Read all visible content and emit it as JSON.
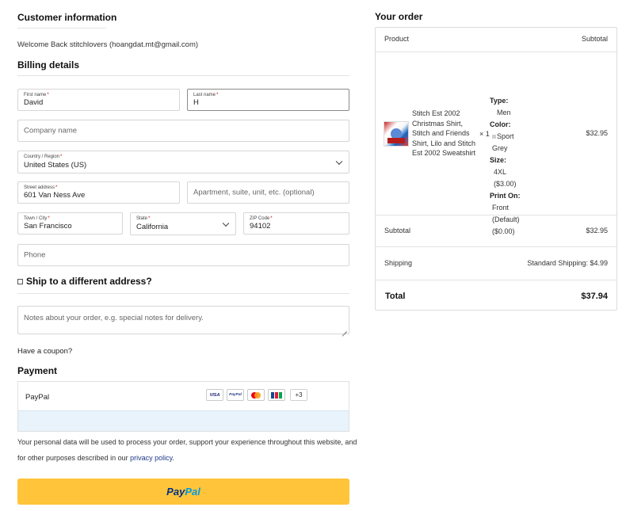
{
  "customer": {
    "title": "Customer information",
    "welcome": "Welcome Back stitchlovers (hoangdat.mt@gmail.com)"
  },
  "billing": {
    "title": "Billing details",
    "first_name": {
      "label": "First name",
      "req": "*",
      "value": "David"
    },
    "last_name": {
      "label": "Last name",
      "req": "*",
      "value": "H"
    },
    "company": {
      "placeholder": "Company name"
    },
    "country": {
      "label": "Country / Region",
      "req": "*",
      "value": "United States (US)"
    },
    "street": {
      "label": "Street address",
      "req": "*",
      "value": "601 Van Ness Ave"
    },
    "apartment": {
      "placeholder": "Apartment, suite, unit, etc. (optional)"
    },
    "city": {
      "label": "Town / City",
      "req": "*",
      "value": "San Francisco"
    },
    "state": {
      "label": "State",
      "req": "*",
      "value": "California"
    },
    "zip": {
      "label": "ZIP Code",
      "req": "*",
      "value": "94102"
    },
    "phone": {
      "placeholder": "Phone"
    }
  },
  "shipping": {
    "label": "Ship to a different address?",
    "checked": false
  },
  "notes": {
    "placeholder": "Notes about your order, e.g. special notes for delivery."
  },
  "coupon": {
    "label": "Have a coupon?"
  },
  "payment": {
    "title": "Payment",
    "method": "PayPal",
    "cards": [
      "visa-card-icon",
      "paypal-card-icon",
      "mastercard-icon",
      "jcb-card-icon"
    ],
    "card_labels": {
      "visa": "VISA",
      "paypal": "PayPal"
    },
    "more": "+3",
    "privacy_text": "Your personal data will be used to process your order, support your experience throughout this website, and for other purposes described in our",
    "privacy_link": "privacy policy",
    "privacy_end": ".",
    "button": {
      "part1": "Pay",
      "part2": "Pal"
    }
  },
  "order": {
    "title": "Your order",
    "header": {
      "product": "Product",
      "subtotal": "Subtotal"
    },
    "item": {
      "name": "Stitch Est 2002 Christmas Shirt, Stitch and Friends Shirt, Lilo and Stitch Est 2002 Sweatshirt",
      "qty": "× 1",
      "price": "$32.95",
      "meta": [
        {
          "key": "Type:",
          "value": "Men"
        },
        {
          "key": "Color:",
          "value": "Sport Grey"
        },
        {
          "key": "Size:",
          "value": "4XL ($3.00)"
        },
        {
          "key": "Print On:",
          "value": "Front (Default) ($0.00)"
        }
      ]
    },
    "subtotal": {
      "label": "Subtotal",
      "value": "$32.95"
    },
    "shipping": {
      "label": "Shipping",
      "value": "Standard Shipping: $4.99"
    },
    "total": {
      "label": "Total",
      "value": "$37.94"
    }
  },
  "colors": {
    "paypal_yellow": "#ffc439",
    "paypal_dark": "#003087",
    "paypal_light": "#009cde",
    "pay_area": "#e8f3fb"
  }
}
